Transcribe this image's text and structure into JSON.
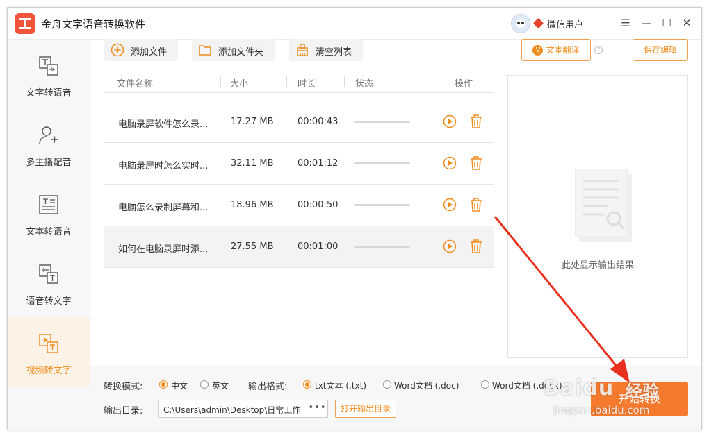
{
  "window": {
    "title": "金舟文字语音转换软件",
    "user_name": "微信用户",
    "controls": [
      "☰",
      "—",
      "☐",
      "✕"
    ]
  },
  "sidebar": {
    "items": [
      {
        "label": "文字转语音",
        "icon": "text-to-speech-icon",
        "active": false
      },
      {
        "label": "多主播配音",
        "icon": "multi-voice-icon",
        "active": false
      },
      {
        "label": "文本转语音",
        "icon": "document-to-speech-icon",
        "active": false
      },
      {
        "label": "语音转文字",
        "icon": "speech-to-text-icon",
        "active": false
      },
      {
        "label": "视频转文字",
        "icon": "video-to-text-icon",
        "active": true
      }
    ]
  },
  "toolbar": {
    "add_file": "添加文件",
    "add_folder": "添加文件夹",
    "clear_list": "清空列表",
    "translate": "文本翻译",
    "translate_badge": "V",
    "save_edit": "保存编辑",
    "help": "?"
  },
  "table": {
    "headers": {
      "name": "文件名称",
      "size": "大小",
      "duration": "时长",
      "status": "状态",
      "action": "操作"
    },
    "rows": [
      {
        "name": "电脑录屏软件怎么录...",
        "size": "17.27 MB",
        "duration": "00:00:43"
      },
      {
        "name": "电脑录屏时怎么实时...",
        "size": "32.11 MB",
        "duration": "00:01:12"
      },
      {
        "name": "电脑怎么录制屏幕和...",
        "size": "18.96 MB",
        "duration": "00:00:50"
      },
      {
        "name": "如何在电脑录屏时添...",
        "size": "27.55 MB",
        "duration": "00:01:00"
      }
    ]
  },
  "preview": {
    "placeholder": "此处显示输出结果"
  },
  "bottom": {
    "mode_label": "转换模式:",
    "mode_options": [
      "中文",
      "英文"
    ],
    "mode_selected": 0,
    "format_label": "输出格式:",
    "format_options": [
      "txt文本 (.txt)",
      "Word文档 (.doc)",
      "Word文档 (.docx)"
    ],
    "format_selected": 0,
    "dir_label": "输出目录:",
    "dir_value": "C:\\Users\\admin\\Desktop\\日常工作",
    "dir_browse": "•••",
    "open_dir": "打开输出目录",
    "start": "开始转换"
  },
  "watermark": {
    "brand": "Baidu",
    "brand_cn": "经验",
    "url": "jingyan.baidu.com"
  },
  "colors": {
    "accent": "#f08c1e",
    "start": "#f57a2e",
    "logo": "#f0553b",
    "annotation": "#e8321f"
  }
}
